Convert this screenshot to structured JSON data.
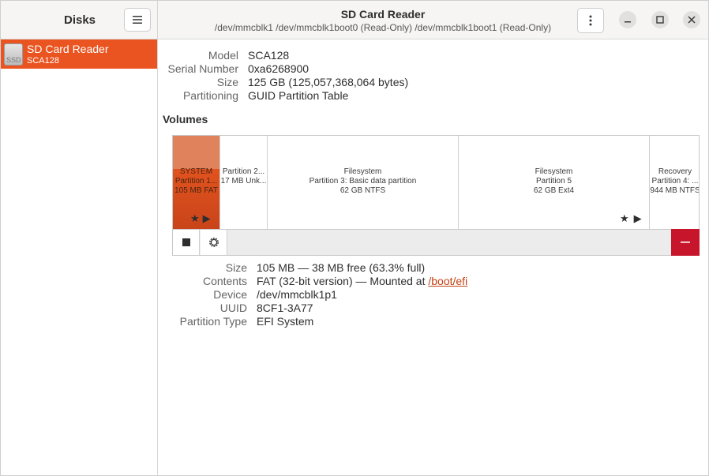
{
  "sidebar": {
    "title": "Disks",
    "drives": [
      {
        "name": "SD Card Reader",
        "subtitle": "SCA128",
        "icon_label": "SSD",
        "selected": true
      }
    ]
  },
  "header": {
    "title": "SD Card Reader",
    "subtitle": "/dev/mmcblk1 /dev/mmcblk1boot0 (Read-Only) /dev/mmcblk1boot1 (Read-Only)"
  },
  "drive_info": {
    "model_label": "Model",
    "model": "SCA128",
    "serial_label": "Serial Number",
    "serial": "0xa6268900",
    "size_label": "Size",
    "size": "125 GB (125,057,368,064 bytes)",
    "partitioning_label": "Partitioning",
    "partitioning": "GUID Partition Table"
  },
  "volumes": {
    "title": "Volumes",
    "partitions": [
      {
        "line1": "SYSTEM",
        "line2": "Partition 1...",
        "line3": "105 MB FAT",
        "selected": true
      },
      {
        "line1": "",
        "line2": "Partition 2...",
        "line3": "17 MB Unk..."
      },
      {
        "line1": "Filesystem",
        "line2": "Partition 3: Basic data partition",
        "line3": "62 GB NTFS"
      },
      {
        "line1": "Filesystem",
        "line2": "Partition 5",
        "line3": "62 GB Ext4"
      },
      {
        "line1": "Recovery",
        "line2": "Partition 4: ...",
        "line3": "944 MB NTFS"
      }
    ]
  },
  "partition_details": {
    "size_label": "Size",
    "size": "105 MB — 38 MB free (63.3% full)",
    "contents_label": "Contents",
    "contents": "FAT (32-bit version) — Mounted at ",
    "mount_point": "/boot/efi",
    "device_label": "Device",
    "device": "/dev/mmcblk1p1",
    "uuid_label": "UUID",
    "uuid": "8CF1-3A77",
    "type_label": "Partition Type",
    "type": "EFI System"
  },
  "colors": {
    "accent": "#e95420",
    "danger": "#c7162b",
    "link": "#c34113"
  },
  "icons": {
    "menu": "hamburger-icon",
    "drive_menu": "vertical-dots-icon",
    "minimize": "minimize-icon",
    "maximize": "maximize-icon",
    "close": "close-icon",
    "unmount": "stop-square-icon",
    "settings": "gear-icon",
    "delete": "minus-icon",
    "mounted": "star-icon",
    "play": "play-icon"
  }
}
